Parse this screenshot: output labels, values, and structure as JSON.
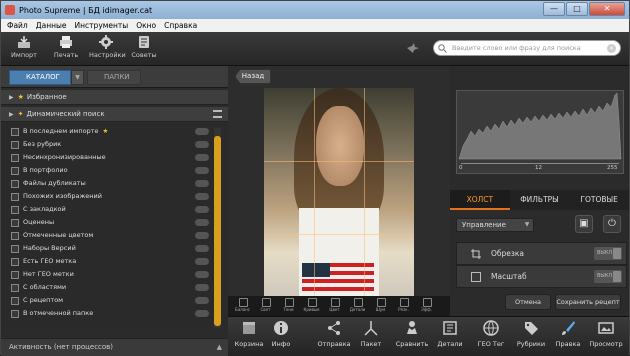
{
  "window": {
    "title": "Photo Supreme | БД idimager.cat",
    "min": "—",
    "max": "□",
    "close": "✕"
  },
  "menu": [
    "Файл",
    "Данные",
    "Инструменты",
    "Окно",
    "Справка"
  ],
  "toolbar": {
    "items": [
      {
        "label": "Импорт",
        "icon": "import-icon"
      },
      {
        "label": "Печать",
        "icon": "printer-icon"
      },
      {
        "label": "Настройки",
        "icon": "gear-icon"
      },
      {
        "label": "Советы",
        "icon": "tips-icon"
      }
    ],
    "search_placeholder": "Введите слово или фразу для поиска"
  },
  "left": {
    "tab_catalog": "КАТАЛОГ",
    "tab_folders": "ПАПКИ",
    "sect_fav": "Избранное",
    "sect_dyn": "Динамический поиск",
    "items": [
      "В последнем импорте",
      "Без рубрик",
      "Несинхронизированные",
      "В портфолио",
      "Файлы дубликаты",
      "Похожих изображений",
      "С закладкой",
      "Оценены",
      "Отмеченные цветом",
      "Наборы Версий",
      "Есть ГЕО метка",
      "Нет ГЕО метки",
      "С областями",
      "С рецептом",
      "В отмеченной папке"
    ],
    "activity": "Активность (нет процессов)"
  },
  "center": {
    "back": "Назад",
    "photo_tools": [
      "Баланс",
      "Свет",
      "Тени",
      "Кривые",
      "Цвет",
      "Детали",
      "Шум",
      "Резк.",
      "Эфф."
    ]
  },
  "right": {
    "histogram_labels": {
      "left": "0",
      "mid": "12",
      "right": "255"
    },
    "tabs": [
      "ХОЛСТ",
      "ФИЛЬТРЫ",
      "ГОТОВЫЕ"
    ],
    "active_tab": 0,
    "management": "Управление",
    "panel_crop": "Обрезка",
    "panel_scale": "Масштаб",
    "switch_off": "ВЫКЛ",
    "cancel": "Отмена",
    "save_recipe": "Сохранить рецепт"
  },
  "bottom": [
    {
      "label": "Корзина",
      "icon": "basket-icon",
      "badge": "0"
    },
    {
      "label": "Инфо",
      "icon": "info-icon"
    },
    {
      "label": "Отправка",
      "icon": "share-icon"
    },
    {
      "label": "Пакет",
      "icon": "batch-icon"
    },
    {
      "label": "Сравнить",
      "icon": "compare-icon"
    },
    {
      "label": "Детали",
      "icon": "details-icon"
    },
    {
      "label": "ГЕО Тег",
      "icon": "globe-icon"
    },
    {
      "label": "Рубрики",
      "icon": "tag-icon"
    },
    {
      "label": "Правка",
      "icon": "brush-icon"
    },
    {
      "label": "Просмотр",
      "icon": "preview-icon"
    }
  ],
  "colors": {
    "accent": "#e8701a",
    "catalog_tab": "#4c7fb0",
    "scroll_thumb": "#d8a01c"
  }
}
